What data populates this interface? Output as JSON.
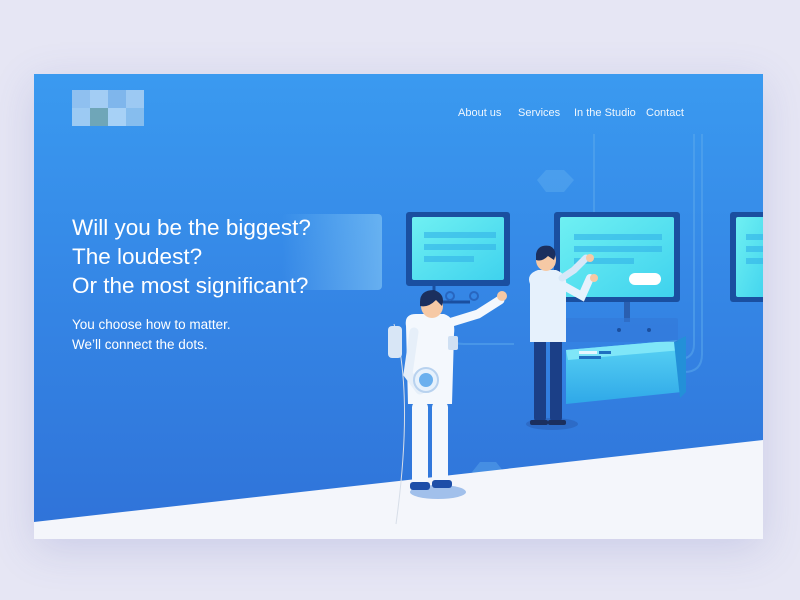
{
  "logo": {
    "icon": "pixelated-logo-icon",
    "colors": [
      "#7fb8ee",
      "#93c5f2",
      "#6fa6c8",
      "#a9d1f5",
      "#5fb0f0"
    ]
  },
  "nav": {
    "items": [
      {
        "label": "About us"
      },
      {
        "label": "Services"
      },
      {
        "label": "In the Studio"
      },
      {
        "label": "Contact"
      }
    ]
  },
  "hero": {
    "headline": [
      "Will you be the biggest?",
      "The loudest?",
      "Or the most significant?"
    ],
    "subline": [
      "You choose how to matter.",
      "We’ll connect the dots."
    ]
  },
  "illustration": {
    "icon": "astronaut-and-office-worker-at-screens-illustration",
    "colors": {
      "screen": "#5ee8f0",
      "screen_frame": "#1a4fa0",
      "console": "#3fc4ee",
      "floor": "#f4f6fb"
    }
  }
}
